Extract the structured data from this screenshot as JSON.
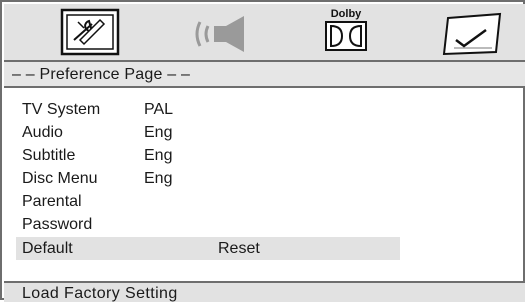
{
  "toolbar": {
    "tabs": [
      {
        "name": "general-setup",
        "icon": "tv-tools-icon"
      },
      {
        "name": "audio-setup",
        "icon": "speaker-icon"
      },
      {
        "name": "dolby-setup",
        "icon": "dolby-icon",
        "label": "Dolby"
      },
      {
        "name": "preference-setup",
        "icon": "checkmark-box-icon"
      }
    ]
  },
  "header": {
    "title": "– – Preference Page – –"
  },
  "menu": {
    "items": [
      {
        "label": "TV System",
        "value": "PAL"
      },
      {
        "label": "Audio",
        "value": "Eng"
      },
      {
        "label": "Subtitle",
        "value": "Eng"
      },
      {
        "label": "Disc Menu",
        "value": "Eng"
      },
      {
        "label": "Parental",
        "value": ""
      },
      {
        "label": "Password",
        "value": ""
      },
      {
        "label": "Default",
        "value": "",
        "submenu": "Reset",
        "selected": true
      }
    ]
  },
  "footer": {
    "status": "Load Factory Setting"
  },
  "colors": {
    "bar": "#e2e2e2",
    "border": "#6e6e6e",
    "text": "#1a1a1a"
  }
}
